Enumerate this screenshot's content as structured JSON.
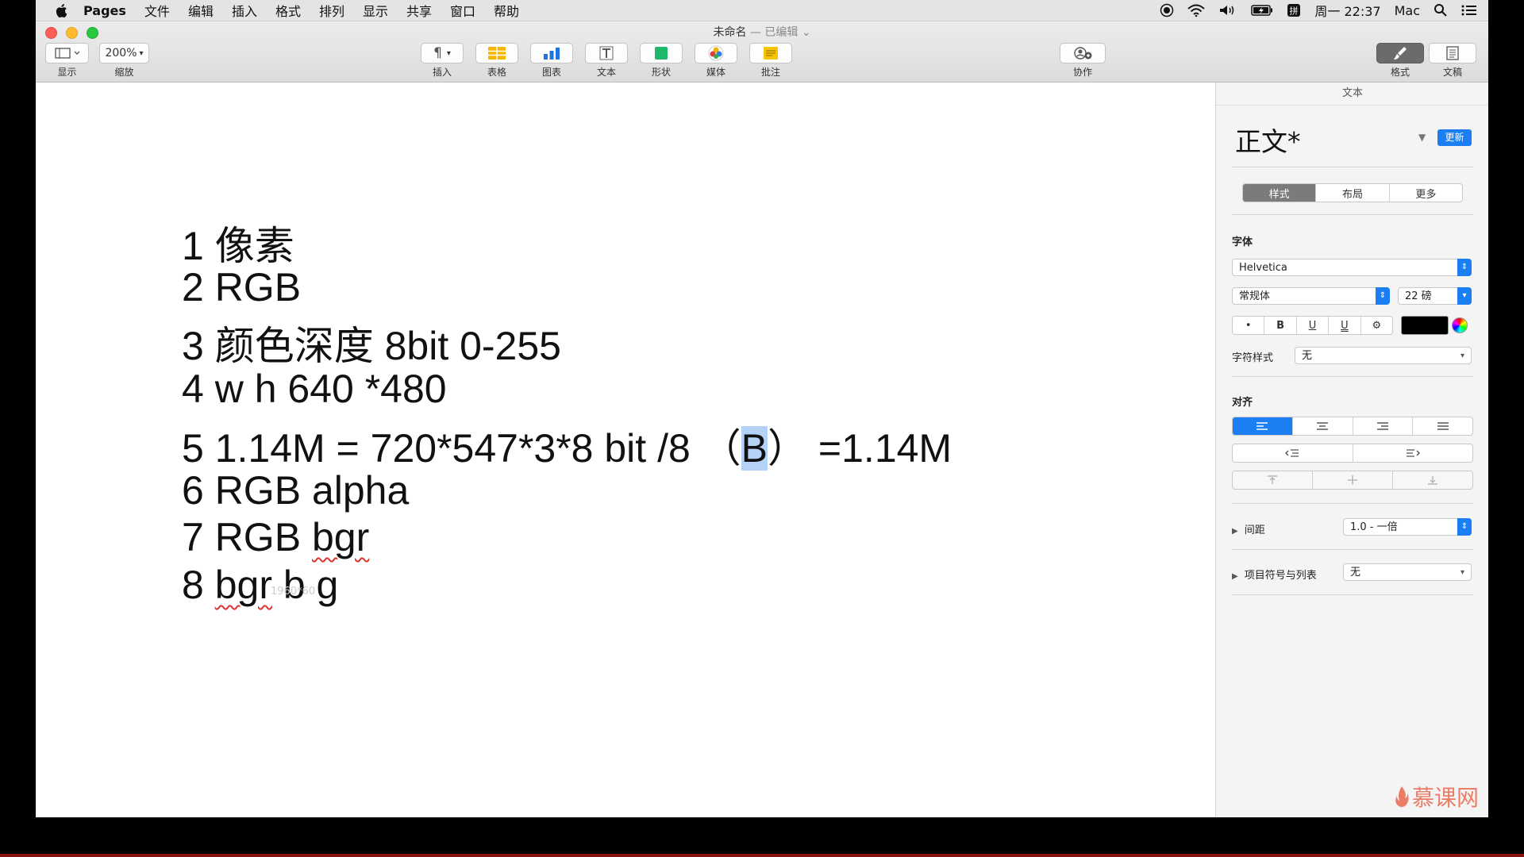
{
  "menubar": {
    "app": "Pages",
    "items": [
      "文件",
      "编辑",
      "插入",
      "格式",
      "排列",
      "显示",
      "共享",
      "窗口",
      "帮助"
    ],
    "clock": "周一 22:37",
    "user": "Mac"
  },
  "window": {
    "title": "未命名",
    "status": "— 已编辑",
    "toolbar": {
      "view_label": "显示",
      "zoom_value": "200%",
      "zoom_label": "缩放",
      "insert_label": "插入",
      "table_label": "表格",
      "chart_label": "图表",
      "text_label": "文本",
      "shape_label": "形状",
      "media_label": "媒体",
      "comment_label": "批注",
      "collab_label": "协作",
      "format_label": "格式",
      "document_label": "文稿"
    }
  },
  "document": {
    "lines": [
      "1 像素",
      "2 RGB",
      "3 颜色深度 8bit 0-255",
      "4 w h 640 *480"
    ],
    "line5": {
      "before": "5 1.14M = 720*547*3*8 bit /8 （",
      "selected": "B",
      "after": "） =1.14M"
    },
    "line6": "6 RGB alpha",
    "line7": {
      "prefix": "7 RGB ",
      "misspelled": "bgr"
    },
    "line8": {
      "prefix": "8 ",
      "misspelled": "bgr",
      "suffix": " b g"
    },
    "ghost_text": "1960*60"
  },
  "inspector": {
    "header": "文本",
    "paragraph_style": "正文*",
    "update_label": "更新",
    "tabs": [
      "样式",
      "布局",
      "更多"
    ],
    "font_section": "字体",
    "font_family": "Helvetica",
    "font_typeface": "常规体",
    "font_size": "22 磅",
    "char_buttons": [
      "•",
      "B",
      "U",
      "U",
      "⚙"
    ],
    "char_style_label": "字符样式",
    "char_style_value": "无",
    "align_section": "对齐",
    "spacing_label": "间距",
    "spacing_value": "1.0 - 一倍",
    "bullets_label": "项目符号与列表",
    "bullets_value": "无"
  },
  "watermark": "慕课网",
  "colors": {
    "accent": "#1b7ef2",
    "selection": "#b4d2f5",
    "spell_error": "#d33333"
  }
}
